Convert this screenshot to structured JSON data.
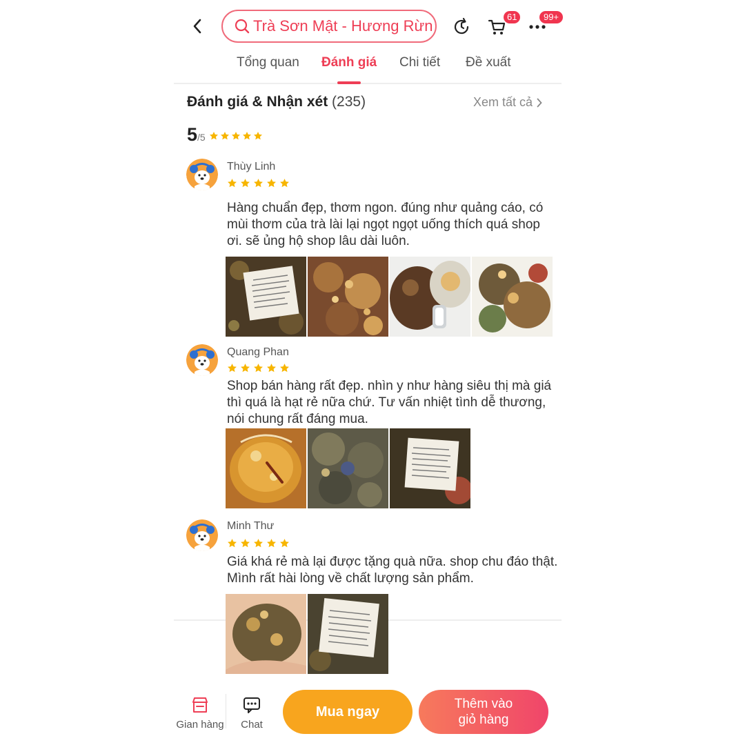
{
  "header": {
    "search_value": "Trà Sơn Mật - Hương Rừng",
    "cart_badge": "61",
    "more_badge": "99+",
    "icons": [
      "chevron-left-icon",
      "search-icon",
      "history-icon",
      "cart-icon",
      "more-icon"
    ]
  },
  "tabs": [
    {
      "label": "Tổng quan",
      "active": false
    },
    {
      "label": "Đánh giá",
      "active": true
    },
    {
      "label": "Chi tiết",
      "active": false
    },
    {
      "label": "Đề xuất",
      "active": false
    }
  ],
  "reviews_section": {
    "title": "Đánh giá & Nhận xét",
    "count": "(235)",
    "see_all": "Xem tất cả",
    "rating_value": "5",
    "rating_scale": "/5",
    "rating_stars": 5
  },
  "reviews": [
    {
      "name": "Thùy Linh",
      "stars": 5,
      "text": "Hàng chuẩn đẹp, thơm ngon. đúng như quảng cáo, có mùi thơm của trà lài lại ngọt ngọt uống thích quá shop ơi. sẽ ủng hộ shop lâu dài luôn.",
      "photo_count": 4
    },
    {
      "name": "Quang Phan",
      "stars": 5,
      "text": "Shop bán hàng rất đẹp. nhìn y như hàng siêu thị mà giá thì quá là hạt rẻ nữa chứ. Tư vấn nhiệt tình dễ thương, nói chung rất đáng mua.",
      "photo_count": 3
    },
    {
      "name": "Minh Thư",
      "stars": 5,
      "text": "Giá khá rẻ mà lại được tặng quà nữa. shop chu đáo thật. Mình rất hài lòng về chất lượng sản phẩm.",
      "photo_count": 2
    }
  ],
  "bottom_bar": {
    "shop_label": "Gian hàng",
    "chat_label": "Chat",
    "buy_now": "Mua ngay",
    "add_to_cart": "Thêm vào\ngiỏ hàng"
  },
  "colors": {
    "accent": "#ee3e55",
    "star": "#f7b500",
    "buy": "#f8a51e",
    "add_start": "#f77a5c",
    "add_end": "#f0456a"
  }
}
